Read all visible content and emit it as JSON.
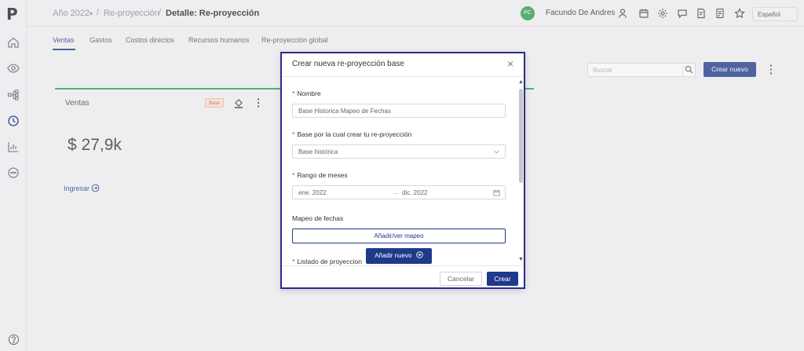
{
  "breadcrumb": {
    "year": "Año 2022",
    "reproyeccion": "Re-proyección",
    "current": "Detalle: Re-proyección"
  },
  "user": {
    "initials": "PC",
    "name": "Facundo De Andres"
  },
  "language": "Español",
  "tabs": [
    {
      "label": "Ventas"
    },
    {
      "label": "Gastos"
    },
    {
      "label": "Costos directos"
    },
    {
      "label": "Recursos humanos"
    },
    {
      "label": "Re-proyección global"
    }
  ],
  "card": {
    "title": "Ventas",
    "badge": "Base",
    "value": "$ 27,9k",
    "link": "Ingresar"
  },
  "toolbar": {
    "search_placeholder": "Buscar",
    "create_label": "Crear nuevo"
  },
  "modal": {
    "title": "Crear nueva re-proyección base",
    "close": "×",
    "nombre_label": "Nombre",
    "nombre_value": "Base Historica Mapeo de Fechas",
    "base_label": "Base por la cual crear tu re-proyección",
    "base_value": "Base histórica",
    "rango_label": "Rango de meses",
    "rango_start": "ene. 2022",
    "rango_end": "dic. 2022",
    "mapeo_label": "Mapeo de fechas",
    "mapeo_button": "Añadir/ver mapeo",
    "listado_label": "Listado de proyeccion",
    "add_new_button": "Añadir nuevo",
    "cancel_label": "Cancelar",
    "create_label": "Crear"
  },
  "colors": {
    "primary": "#1f3a8a",
    "accent_green": "#2e9e4b",
    "badge_bg": "#fde3d7"
  }
}
